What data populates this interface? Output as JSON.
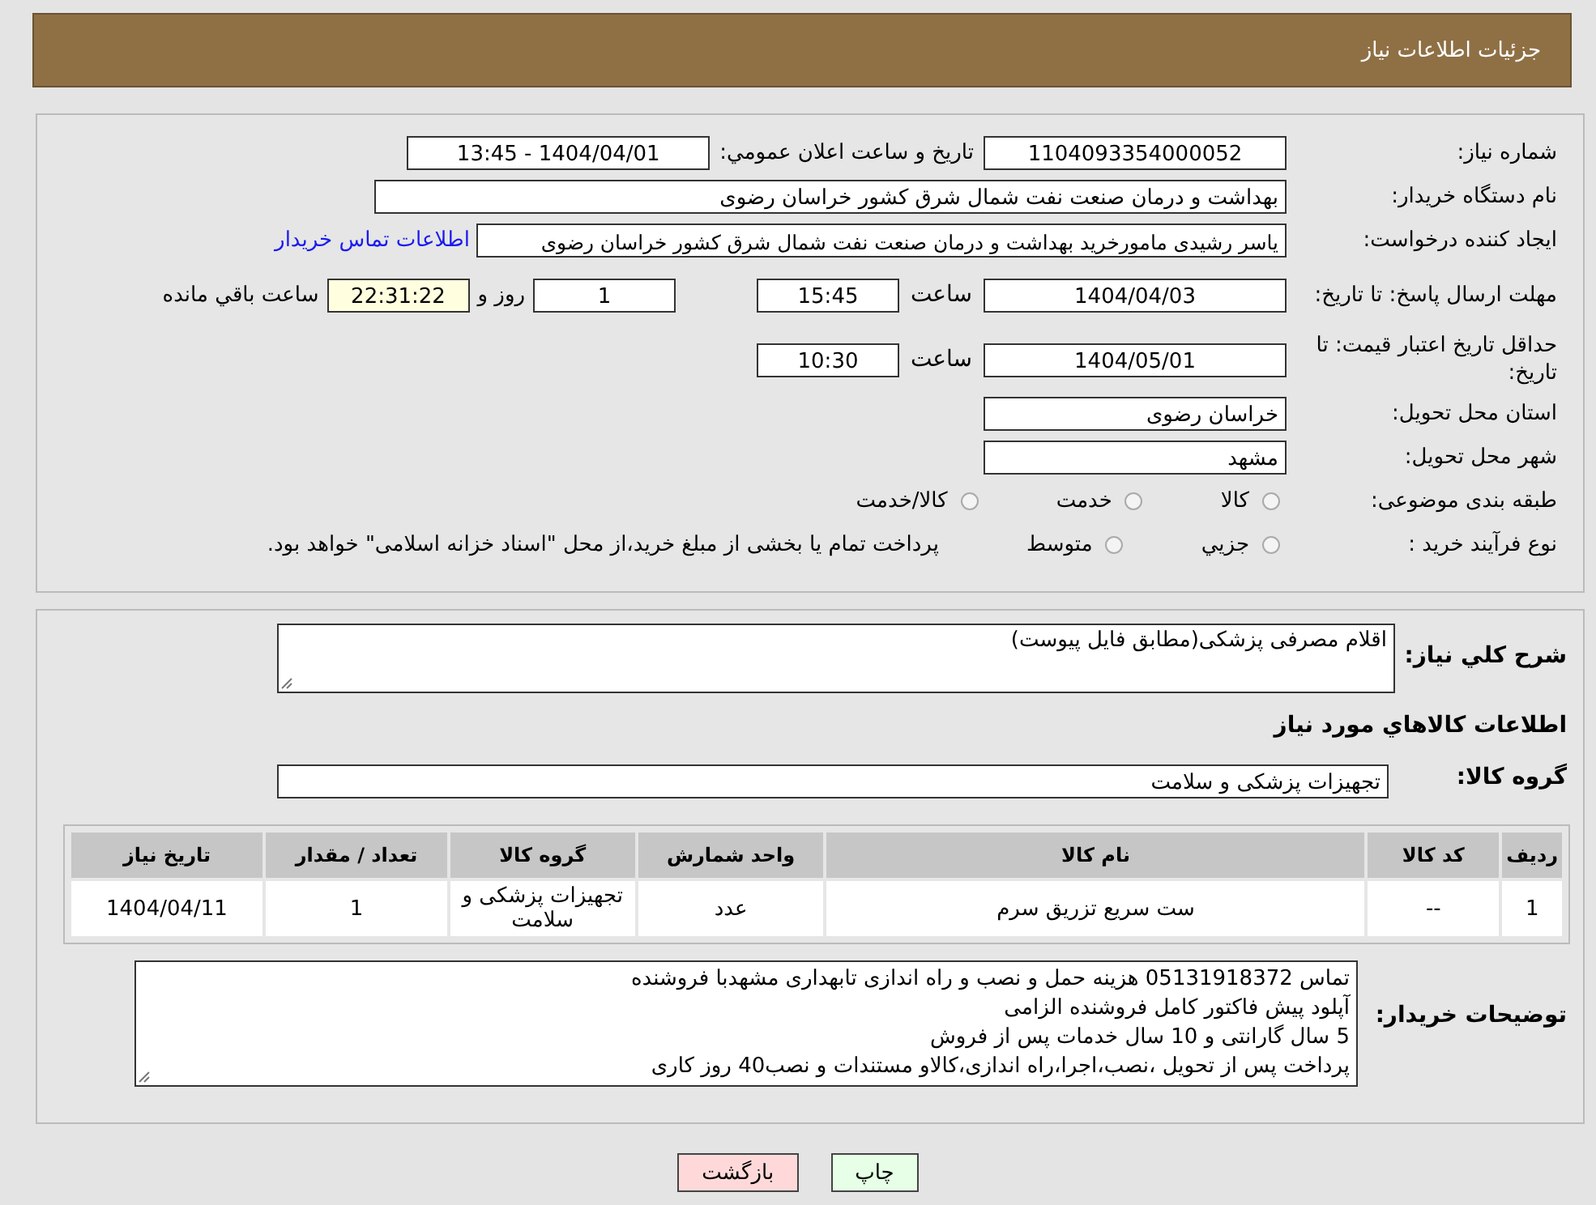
{
  "header": {
    "title": "جزئیات اطلاعات نیاز"
  },
  "need_number": {
    "label": "شماره نیاز:",
    "value": "1104093354000052"
  },
  "announce": {
    "label": "تاریخ و ساعت اعلان عمومي:",
    "value": "1404/04/01 - 13:45"
  },
  "buyer": {
    "label": "نام دستگاه خریدار:",
    "value": "بهداشت و درمان صنعت نفت شمال شرق کشور   خراسان رضوی"
  },
  "requester": {
    "label": "ایجاد کننده درخواست:",
    "value": "یاسر رشیدی مامورخرید بهداشت و درمان صنعت نفت شمال شرق کشور   خراسان رضوی",
    "link": "اطلاعات تماس خریدار"
  },
  "reply_deadline": {
    "label": "مهلت ارسال پاسخ: تا تاریخ:",
    "date": "1404/04/03",
    "time_label": "ساعت",
    "time": "15:45",
    "days": "1",
    "days_label": "روز و",
    "remaining": "22:31:22",
    "remaining_label": "ساعت باقي مانده"
  },
  "price_validity": {
    "label": "حداقل تاریخ اعتبار قیمت: تا تاریخ:",
    "date": "1404/05/01",
    "time_label": "ساعت",
    "time": "10:30"
  },
  "province": {
    "label": "استان محل تحویل:",
    "value": "خراسان رضوی"
  },
  "city": {
    "label": "شهر محل تحویل:",
    "value": "مشهد"
  },
  "category": {
    "label": "طبقه بندی موضوعی:",
    "options": [
      {
        "label": "کالا",
        "selected": false
      },
      {
        "label": "خدمت",
        "selected": false
      },
      {
        "label": "کالا/خدمت",
        "selected": false
      }
    ]
  },
  "purchase_type": {
    "label": "نوع فرآیند خرید :",
    "options": [
      {
        "label": "جزيي",
        "selected": false
      },
      {
        "label": "متوسط",
        "selected": false
      }
    ],
    "note": "پرداخت تمام یا بخشی از مبلغ خرید،از محل \"اسناد خزانه اسلامی\" خواهد بود."
  },
  "summary": {
    "label": "شرح کلي نیاز:",
    "value": "اقلام مصرفی پزشکی(مطابق فایل پیوست)"
  },
  "goods_heading": "اطلاعات کالاهاي مورد نیاز",
  "goods_group": {
    "label": "گروه کالا:",
    "value": "تجهیزات پزشکی و سلامت"
  },
  "table": {
    "columns": [
      "ردیف",
      "کد کالا",
      "نام کالا",
      "واحد شمارش",
      "گروه کالا",
      "تعداد / مقدار",
      "تاریخ نیاز"
    ],
    "rows": [
      [
        "1",
        "--",
        "ست سریع تزریق سرم",
        "عدد",
        "تجهیزات پزشکی و سلامت",
        "1",
        "1404/04/11"
      ]
    ]
  },
  "buyer_notes": {
    "label": "توضیحات خریدار:",
    "lines": [
      "تماس 05131918372 هزینه حمل و نصب و راه اندازی تابهداری مشهدبا فروشنده",
      "آپلود پیش فاکتور کامل فروشنده الزامی",
      "5 سال گارانتی و 10 سال خدمات پس از فروش",
      "پرداخت پس از تحویل ،نصب،اجرا،راه اندازی،کالاو مستندات و نصب40 روز کاری"
    ]
  },
  "buttons": [
    {
      "label": "چاپ",
      "kind": "print"
    },
    {
      "label": "بازگشت",
      "kind": "back"
    }
  ]
}
